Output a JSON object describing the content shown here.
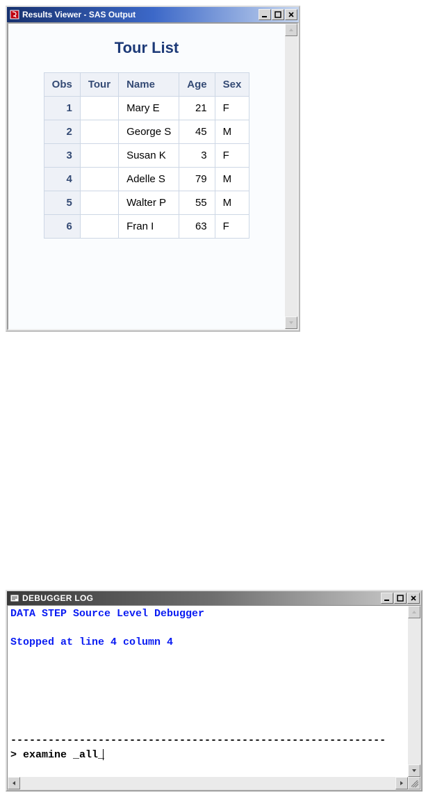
{
  "results_window": {
    "title": "Results Viewer - SAS Output",
    "report_title": "Tour List",
    "columns": [
      "Obs",
      "Tour",
      "Name",
      "Age",
      "Sex"
    ],
    "rows": [
      {
        "obs": "1",
        "tour": "",
        "name": "Mary E",
        "age": "21",
        "sex": "F"
      },
      {
        "obs": "2",
        "tour": "",
        "name": "George S",
        "age": "45",
        "sex": "M"
      },
      {
        "obs": "3",
        "tour": "",
        "name": "Susan K",
        "age": "3",
        "sex": "F"
      },
      {
        "obs": "4",
        "tour": "",
        "name": "Adelle S",
        "age": "79",
        "sex": "M"
      },
      {
        "obs": "5",
        "tour": "",
        "name": "Walter P",
        "age": "55",
        "sex": "M"
      },
      {
        "obs": "6",
        "tour": "",
        "name": "Fran I",
        "age": "63",
        "sex": "F"
      }
    ]
  },
  "debugger_window": {
    "title": "DEBUGGER LOG",
    "lines": {
      "l1": "DATA STEP Source Level Debugger",
      "l2": "",
      "l3": "Stopped at line 4 column 4",
      "sep": "------------------------------------------------------------",
      "prompt": "> examine _all_"
    }
  }
}
